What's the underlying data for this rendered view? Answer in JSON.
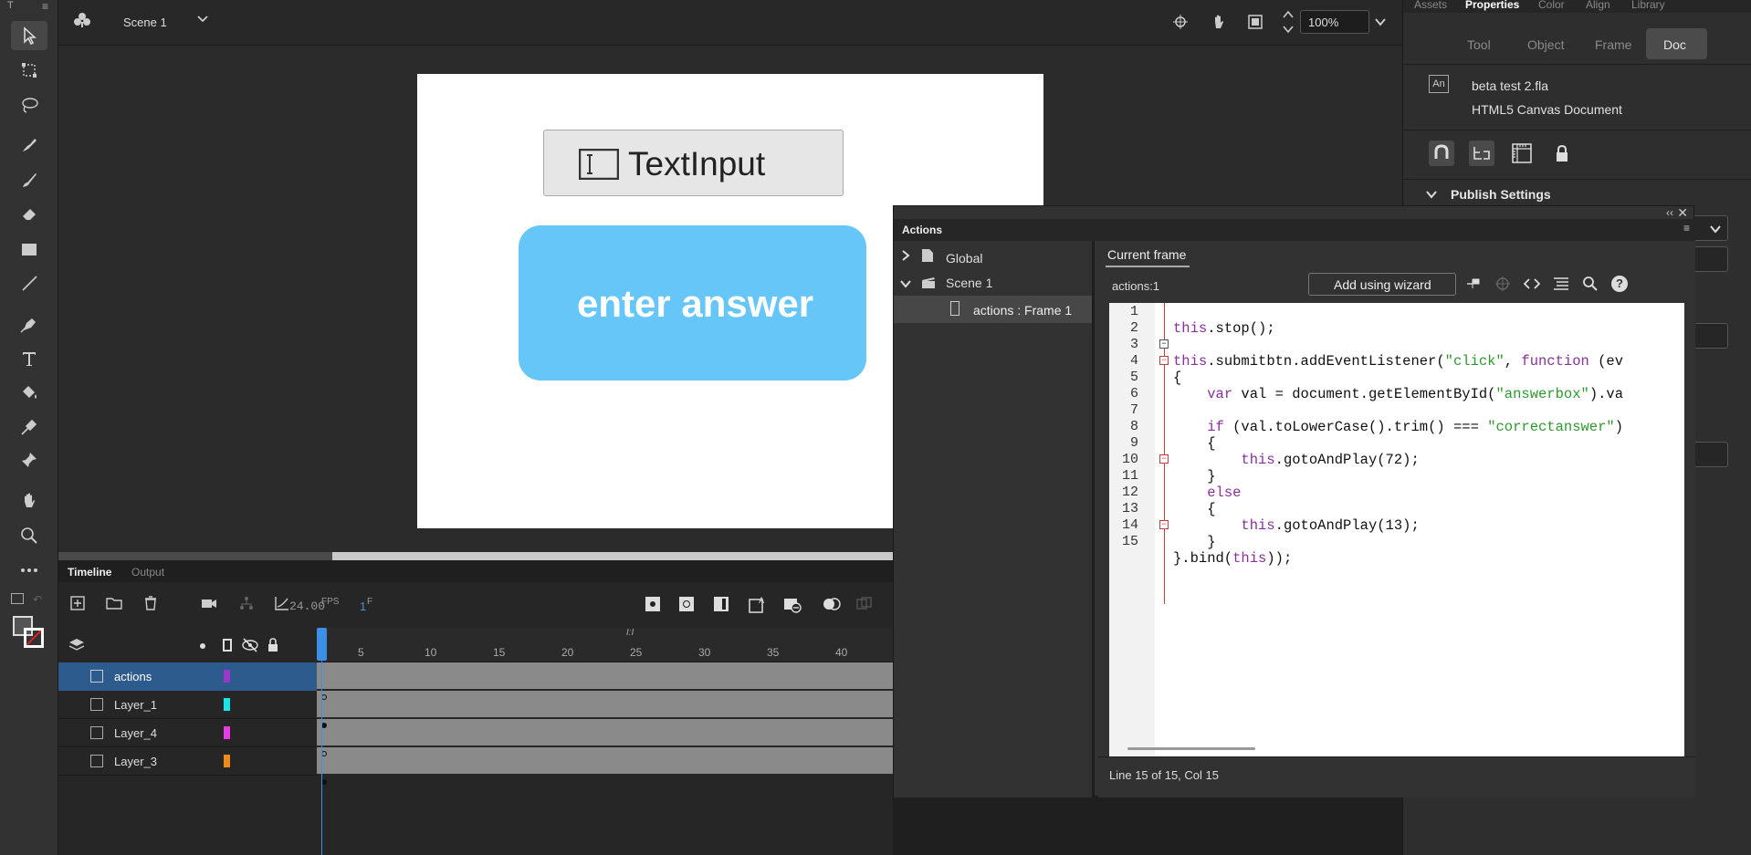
{
  "app_badge": "T",
  "top": {
    "scene": "Scene 1",
    "zoom": "100%"
  },
  "stage": {
    "text_input_label": "TextInput",
    "button_label": "enter answer",
    "button_color": "#66c6f7"
  },
  "right": {
    "tabs": [
      "Assets",
      "Properties",
      "Color",
      "Align",
      "Library"
    ],
    "subtabs": [
      "Tool",
      "Object",
      "Frame",
      "Doc"
    ],
    "doc_badge": "An",
    "file_name": "beta test 2.fla",
    "doc_type": "HTML5 Canvas Document",
    "publish_settings": "Publish Settings"
  },
  "timeline": {
    "tabs": [
      "Timeline",
      "Output"
    ],
    "fps": "24.00",
    "fps_unit": "FPS",
    "frame": "1",
    "frame_unit": "F",
    "ruler": [
      "5",
      "10",
      "15",
      "20",
      "25",
      "30",
      "35",
      "40"
    ],
    "layers": [
      {
        "name": "actions",
        "color": "#9b38c9"
      },
      {
        "name": "Layer_1",
        "color": "#19e6e6"
      },
      {
        "name": "Layer_4",
        "color": "#e63ce6"
      },
      {
        "name": "Layer_3",
        "color": "#f08a19"
      }
    ]
  },
  "actions": {
    "title": "Actions",
    "tree": {
      "global": "Global",
      "scene": "Scene 1",
      "frame": "actions : Frame 1"
    },
    "current_frame": "Current frame",
    "location": "actions:1",
    "wizard": "Add using wizard",
    "status": "Line 15 of 15, Col 15",
    "line_numbers": [
      "1",
      "2",
      "3",
      "4",
      "5",
      "6",
      "7",
      "8",
      "9",
      "10",
      "11",
      "12",
      "13",
      "14",
      "15"
    ],
    "code": {
      "l1_this": "this",
      "l1_rest": ".stop();",
      "l3_this": "this",
      "l3_a": ".submitbtn.addEventListener(",
      "l3_str": "\"click\"",
      "l3_b": ", ",
      "l3_fn": "function",
      "l3_c": " (ev",
      "l4": "{",
      "l5_var": "var",
      "l5_a": " val = document.getElementById(",
      "l5_str": "\"answerbox\"",
      "l5_b": ").va",
      "l7_if": "if",
      "l7_a": " (val.toLowerCase().trim() === ",
      "l7_str": "\"correctanswer\"",
      "l7_b": ")",
      "l8": "{",
      "l9_this": "this",
      "l9_rest": ".gotoAndPlay(72);",
      "l10": "}",
      "l11_else": "else",
      "l12": "{",
      "l13_this": "this",
      "l13_rest": ".gotoAndPlay(13);",
      "l14": "}",
      "l15_a": "}.bind(",
      "l15_this": "this",
      "l15_b": "));"
    }
  }
}
